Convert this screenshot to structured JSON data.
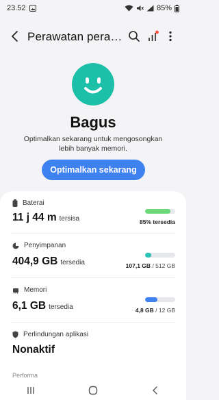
{
  "status_bar": {
    "time": "23.52",
    "battery_percent": "85%"
  },
  "app_bar": {
    "title": "Perawatan perangkat",
    "icons": [
      "back-arrow-icon",
      "search-icon",
      "diagnostics-icon",
      "more-vertical-icon"
    ]
  },
  "status": {
    "face_icon": "smiley-face-icon",
    "face_color": "#1cc0a8",
    "title": "Bagus",
    "description": "Optimalkan sekarang untuk mengosongkan lebih banyak memori.",
    "button_label": "Optimalkan sekarang",
    "button_color": "#3e82f0"
  },
  "battery": {
    "label": "Baterai",
    "value": "11 j 44 m",
    "unit": "tersisa",
    "level": 0.85,
    "color": "#6bd979",
    "detail": "85% tersedia"
  },
  "storage": {
    "label": "Penyimpanan",
    "value": "404,9 GB",
    "unit": "tersedia",
    "level": 0.21,
    "color": "#2bc4b4",
    "used": "107,1 GB",
    "total": "/ 512 GB"
  },
  "memory": {
    "label": "Memori",
    "value": "6,1 GB",
    "unit": "tersedia",
    "level": 0.4,
    "color": "#3e82f0",
    "used": "4,8 GB",
    "total": "/ 12 GB"
  },
  "app_protection": {
    "label": "Perlindungan aplikasi",
    "value": "Nonaktif"
  },
  "next_section_label": "Performa"
}
